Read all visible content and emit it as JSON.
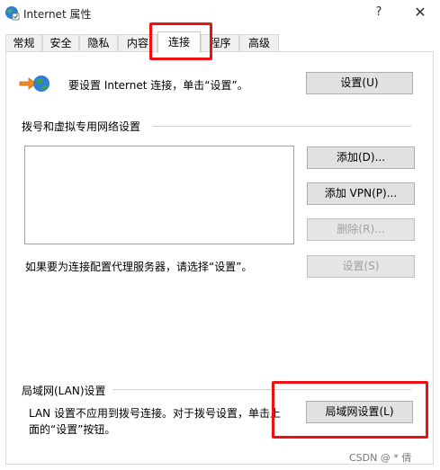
{
  "window": {
    "title": "Internet 属性",
    "help_label": "?",
    "close_label": "✕",
    "icon": "internet-options-globe-icon"
  },
  "tabs": [
    {
      "label": "常规"
    },
    {
      "label": "安全"
    },
    {
      "label": "隐私"
    },
    {
      "label": "内容"
    },
    {
      "label": "连接",
      "active": true
    },
    {
      "label": "程序"
    },
    {
      "label": "高级"
    }
  ],
  "setup": {
    "text": "要设置 Internet 连接，单击“设置”。",
    "button": "设置(U)"
  },
  "dialup": {
    "section_label": "拨号和虚拟专用网络设置",
    "add_button": "添加(D)...",
    "add_vpn_button": "添加 VPN(P)...",
    "remove_button": "删除(R)...",
    "proxy_text": "如果要为连接配置代理服务器，请选择“设置”。",
    "settings_button": "设置(S)"
  },
  "lan": {
    "section_label": "局域网(LAN)设置",
    "text_line1": "LAN 设置不应用到拨号连接。对于拨号设置，单击上",
    "text_line2": "面的“设置”按钮。",
    "button": "局域网设置(L)"
  },
  "watermark": "CSDN @ * 倩",
  "colors": {
    "highlight": "#ee1111",
    "button_bg": "#e1e1e1",
    "disabled_text": "#a0a0a0"
  }
}
